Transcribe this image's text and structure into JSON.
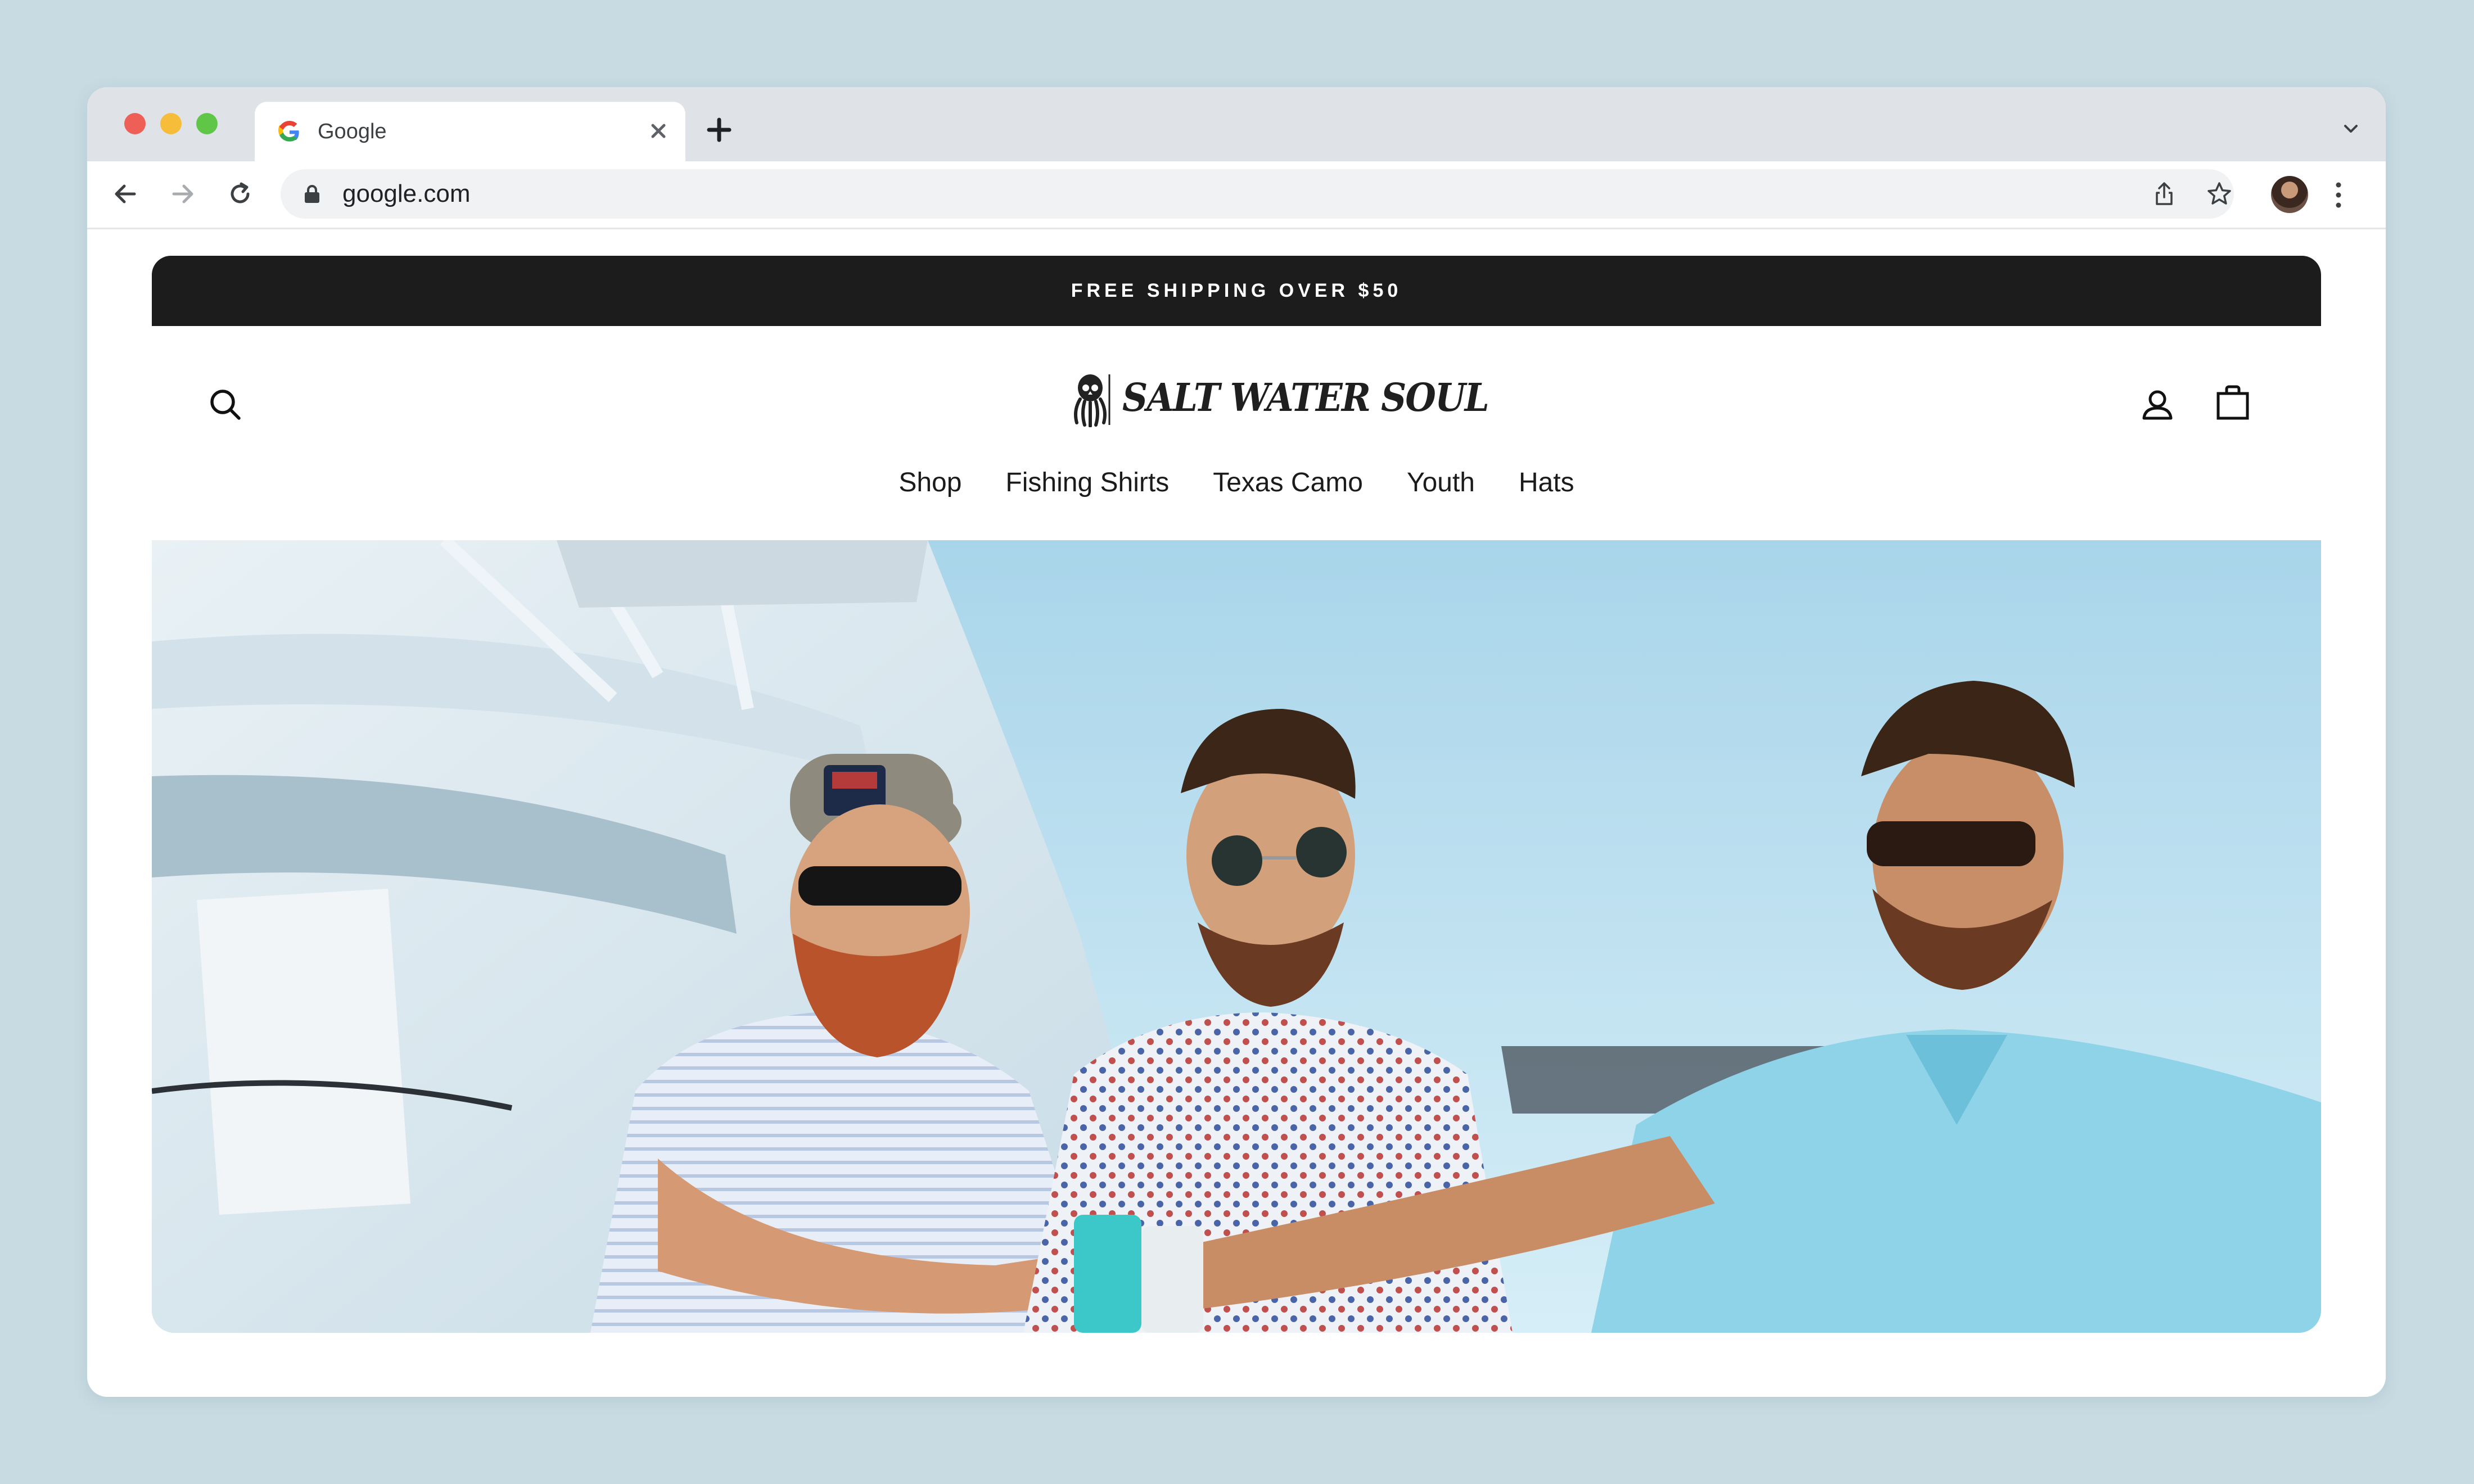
{
  "browser": {
    "tab": {
      "title": "Google"
    },
    "address_bar": {
      "url": "google.com"
    },
    "icons": [
      "google-favicon",
      "close-icon",
      "plus-icon",
      "chevron-down-icon",
      "back-arrow-icon",
      "forward-arrow-icon",
      "reload-icon",
      "lock-icon",
      "share-icon",
      "star-icon",
      "avatar",
      "menu-dots-icon"
    ]
  },
  "site": {
    "announcement": "FREE SHIPPING OVER $50",
    "logo_text": "SALT WATER SOUL",
    "nav": [
      {
        "label": "Shop"
      },
      {
        "label": "Fishing Shirts"
      },
      {
        "label": "Texas Camo"
      },
      {
        "label": "Youth"
      },
      {
        "label": "Hats"
      }
    ],
    "header_icons": [
      "search-icon",
      "account-icon",
      "cart-bag-icon"
    ],
    "hero": {
      "subject": "three men on a boat dock wearing polo and fishing shirts"
    },
    "colors": {
      "announcement_bg": "#1d1c1c",
      "page_bg": "#c8dbe3",
      "sky": "#b7dcec",
      "teal_shirt": "#8fd3e8"
    }
  }
}
